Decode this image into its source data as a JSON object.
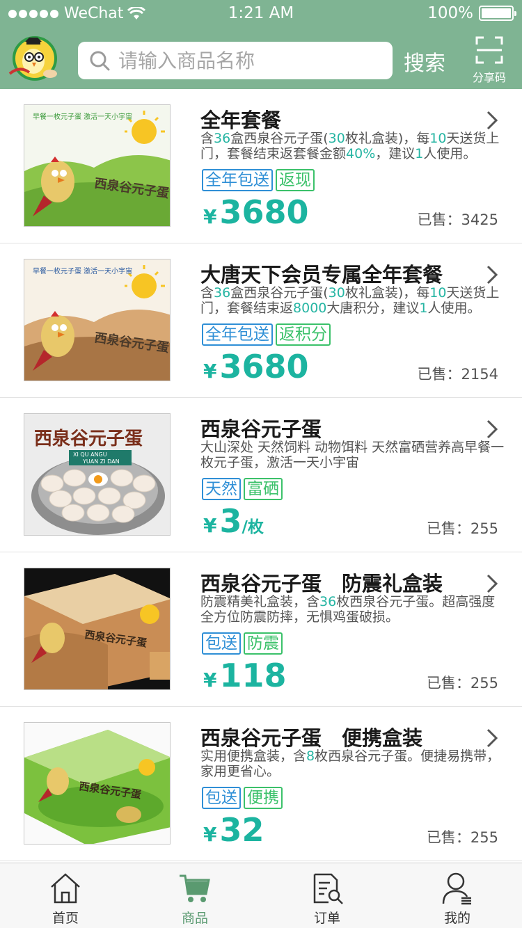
{
  "status_bar": {
    "carrier": "WeChat",
    "time": "1:21 AM",
    "battery": "100%"
  },
  "header": {
    "search_placeholder": "请输入商品名称",
    "search_button": "搜索",
    "share_label": "分享码"
  },
  "products": [
    {
      "title": "全年套餐",
      "desc_parts": [
        "含",
        "36",
        "盒西泉谷元子蛋(",
        "30",
        "枚礼盒装)，每",
        "10",
        "天送货上门，套餐结束返套餐金额",
        "40%",
        "，建议",
        "1",
        "人使用。"
      ],
      "tags": [
        {
          "text": "全年包送",
          "color": "blue"
        },
        {
          "text": "返现",
          "color": "green"
        }
      ],
      "currency": "¥",
      "price": "3680",
      "unit": "",
      "sold": "已售：3425"
    },
    {
      "title": "大唐天下会员专属全年套餐",
      "desc_parts": [
        "含",
        "36",
        "盒西泉谷元子蛋(",
        "30",
        "枚礼盒装)，每",
        "10",
        "天送货上门，套餐结束返",
        "8000",
        "大唐积分，建议",
        "1",
        "人使用。"
      ],
      "tags": [
        {
          "text": "全年包送",
          "color": "blue"
        },
        {
          "text": "返积分",
          "color": "green"
        }
      ],
      "currency": "¥",
      "price": "3680",
      "unit": "",
      "sold": "已售：2154"
    },
    {
      "title": "西泉谷元子蛋",
      "desc_parts": [
        "大山深处 天然饲料 动物饵料 天然富硒营养高早餐一枚元子蛋，激活一天小宇宙"
      ],
      "tags": [
        {
          "text": "天然",
          "color": "blue"
        },
        {
          "text": "富硒",
          "color": "green"
        }
      ],
      "currency": "¥",
      "price": "3",
      "unit": "/枚",
      "sold": "已售：255"
    },
    {
      "title": "西泉谷元子蛋　防震礼盒装",
      "desc_parts": [
        "防震精美礼盒装，含",
        "36",
        "枚西泉谷元子蛋。超高强度全方位防震防摔，无惧鸡蛋破损。"
      ],
      "tags": [
        {
          "text": "包送",
          "color": "blue"
        },
        {
          "text": "防震",
          "color": "green"
        }
      ],
      "currency": "¥",
      "price": "118",
      "unit": "",
      "sold": "已售：255"
    },
    {
      "title": "西泉谷元子蛋　便携盒装",
      "desc_parts": [
        "实用便携盒装，含",
        "8",
        "枚西泉谷元子蛋。便捷易携带，家用更省心。"
      ],
      "tags": [
        {
          "text": "包送",
          "color": "blue"
        },
        {
          "text": "便携",
          "color": "green"
        }
      ],
      "currency": "¥",
      "price": "32",
      "unit": "",
      "sold": "已售：255"
    }
  ],
  "package_art": {
    "brand": "西泉谷元子蛋",
    "slogan": "早餐一枚元子蛋 激活一天小宇宙",
    "pinyin_1": "XI QU ANGU",
    "pinyin_2": "YUAN ZI DAN"
  },
  "tabbar": [
    {
      "label": "首页",
      "icon": "home-icon",
      "active": false
    },
    {
      "label": "商品",
      "icon": "cart-icon",
      "active": true
    },
    {
      "label": "订单",
      "icon": "order-search-icon",
      "active": false
    },
    {
      "label": "我的",
      "icon": "user-icon",
      "active": false
    }
  ],
  "colors": {
    "header": "#7fb493",
    "price": "#1cb4a0",
    "highlight": "#26b5a3",
    "tag_blue": "#2f8fd6",
    "tag_green": "#3bc16a",
    "tab_active": "#5a9a70"
  }
}
